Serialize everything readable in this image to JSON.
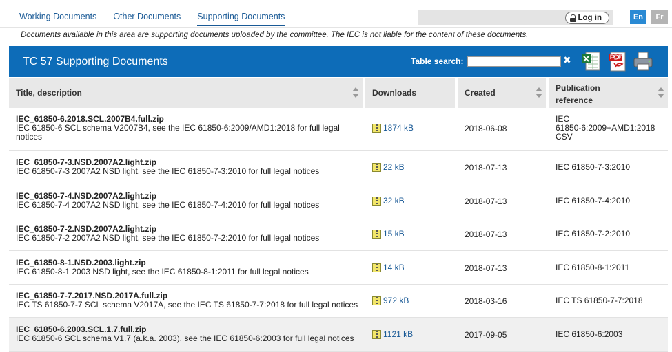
{
  "tabs": [
    {
      "label": "Working Documents",
      "active": false
    },
    {
      "label": "Other Documents",
      "active": false
    },
    {
      "label": "Supporting Documents",
      "active": true
    }
  ],
  "auth": {
    "login_label": "Log in"
  },
  "languages": {
    "en": "En",
    "fr": "Fr"
  },
  "notice": "Documents available in this area are supporting documents uploaded by the committee. The IEC is not liable for the content of these documents.",
  "banner": {
    "title": "TC 57 Supporting Documents",
    "search_label": "Table search:",
    "search_value": "",
    "clear_symbol": "✖",
    "accent_color": "#0d6cb8"
  },
  "table": {
    "columns": {
      "title": "Title, description",
      "downloads": "Downloads",
      "created": "Created",
      "pub_line1": "Publication",
      "pub_line2": "reference"
    },
    "rows": [
      {
        "file": "IEC_61850-6.2018.SCL.2007B4.full.zip",
        "desc1": "IEC 61850-6 SCL schema V2007B4, see the IEC 61850-6:2009/AMD1:2018 for full legal",
        "desc2": "notices",
        "size": "1874 kB",
        "created": "2018-06-08",
        "pub1": "IEC",
        "pub2": "61850-6:2009+AMD1:2018",
        "pub3": "CSV"
      },
      {
        "file": "IEC_61850-7-3.NSD.2007A2.light.zip",
        "desc1": "IEC 61850-7-3 2007A2 NSD light, see the IEC 61850-7-3:2010 for full legal notices",
        "size": "22 kB",
        "created": "2018-07-13",
        "pub1": "IEC 61850-7-3:2010"
      },
      {
        "file": "IEC_61850-7-4.NSD.2007A2.light.zip",
        "desc1": "IEC 61850-7-4 2007A2 NSD light, see the IEC 61850-7-4:2010 for full legal notices",
        "size": "32 kB",
        "created": "2018-07-13",
        "pub1": "IEC 61850-7-4:2010"
      },
      {
        "file": "IEC_61850-7-2.NSD.2007A2.light.zip",
        "desc1": "IEC 61850-7-2 2007A2 NSD light, see the IEC 61850-7-2:2010 for full legal notices",
        "size": "15 kB",
        "created": "2018-07-13",
        "pub1": "IEC 61850-7-2:2010"
      },
      {
        "file": "IEC_61850-8-1.NSD.2003.light.zip",
        "desc1": "IEC 61850-8-1 2003 NSD light, see the IEC 61850-8-1:2011 for full legal notices",
        "size": "14 kB",
        "created": "2018-07-13",
        "pub1": "IEC 61850-8-1:2011"
      },
      {
        "file": "IEC_61850-7-7.2017.NSD.2017A.full.zip",
        "desc1": "IEC TS 61850-7-7 SCL schema V2017A, see the IEC TS 61850-7-7:2018 for full legal notices",
        "size": "972 kB",
        "created": "2018-03-16",
        "pub1": "IEC TS 61850-7-7:2018"
      },
      {
        "file": "IEC_61850-6.2003.SCL.1.7.full.zip",
        "desc1": "IEC 61850-6 SCL schema V1.7 (a.k.a. 2003), see the IEC 61850-6:2003 for full legal notices",
        "size": "1121 kB",
        "created": "2017-09-05",
        "pub1": "IEC 61850-6:2003"
      }
    ]
  }
}
